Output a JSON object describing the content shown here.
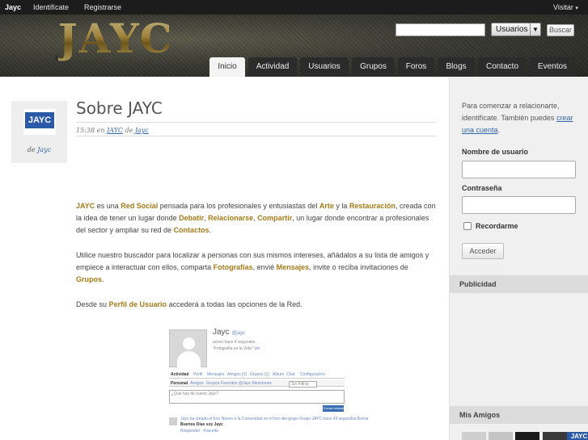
{
  "adminbar": {
    "brand": "Jayc",
    "login_link": "Identifícate",
    "register_link": "Registrarse",
    "visit_menu": "Visitar",
    "caret": "▾"
  },
  "header": {
    "logo_text": "JAYC",
    "search_scope": "Usuarios",
    "search_button": "Buscar",
    "dropdown_arrow": "▼"
  },
  "nav": {
    "tabs": [
      {
        "label": "Inicio",
        "active": true
      },
      {
        "label": "Actividad",
        "active": false
      },
      {
        "label": "Usuarios",
        "active": false
      },
      {
        "label": "Grupos",
        "active": false
      },
      {
        "label": "Foros",
        "active": false
      },
      {
        "label": "Blogs",
        "active": false
      },
      {
        "label": "Contacto",
        "active": false
      },
      {
        "label": "Eventos",
        "active": false
      }
    ]
  },
  "post": {
    "author_logo": "JAYC",
    "by_prefix": "de",
    "author": "Jayc",
    "title": "Sobre JAYC",
    "time": "15:38",
    "in_word": "en",
    "category": "JAYC",
    "by_word": "de",
    "paragraph1": {
      "s1": "JAYC",
      "s2": " es una ",
      "s3": "Red Social",
      "s4": " pensada para los profesionales y entusiastas del ",
      "s5": "Arte",
      "s6": " y la ",
      "s7": "Restauración",
      "s8": ", creada con la idea de tener un lugar donde ",
      "s9": "Debatir",
      "s10": ", ",
      "s11": "Relacionarse",
      "s12": ", ",
      "s13": "Compartir",
      "s14": ", un lugar donde encontrar a profesionales del sector y ampliar su red de ",
      "s15": "Contactos",
      "s16": "."
    },
    "paragraph2": {
      "s1": "Utilice nuestro buscador para localizar a personas con sus mismos intereses, añádalos a su lista de amigos y empiece a interactuar con ellos, comparta ",
      "s2": "Fotografías",
      "s3": ", envié ",
      "s4": "Mensajes",
      "s5": ", invite o reciba invitaciones de ",
      "s6": "Grupos",
      "s7": "."
    },
    "paragraph3": {
      "s1": "Desde su ",
      "s2": "Perfil de Usuario",
      "s3": " accederá a todas las opciones de la Red."
    },
    "embed": {
      "name": "Jayc",
      "handle": "@jayc",
      "status_line": "activo hace 4 segundos",
      "quote": "\"Fotografía es la Vida\"",
      "quote_link": "Ver",
      "nav_items": [
        "Actividad",
        "Perfil",
        "Mensajes",
        "Amigos (0)",
        "Grupos (1)",
        "Álbum",
        "Chat",
        "Configuración"
      ],
      "subnav_items": [
        "Personal",
        "Amigos",
        "Grupos",
        "Favoritos",
        "@Jayc Menciones"
      ],
      "filter_label": "Sin Filtrar",
      "box_prompt": "¿Qué hay de nuevo Jayc?",
      "submit_label": "Enviar Actualización",
      "post_line": "Jayc ha creado el foro Nuevo a la Comunidad en el foro del grupo Grupo JAYC hace 43 segundos",
      "post_link": "Borrar",
      "post_text": "Buenos Días soy Jayc",
      "post_meta": "Responder · Favorito"
    }
  },
  "sidebar": {
    "intro_text": "Para comenzar a relacionarte, identifícate. También puedes",
    "register_link": "crear una cuenta",
    "intro_end": ".",
    "username_label": "Nombre de usuario",
    "password_label": "Contraseña",
    "remember_label": "Recordarme",
    "login_button": "Acceder",
    "ads_title": "Publicidad",
    "friends_title": "Mis Amigos",
    "friend_badge": "JAYC"
  }
}
